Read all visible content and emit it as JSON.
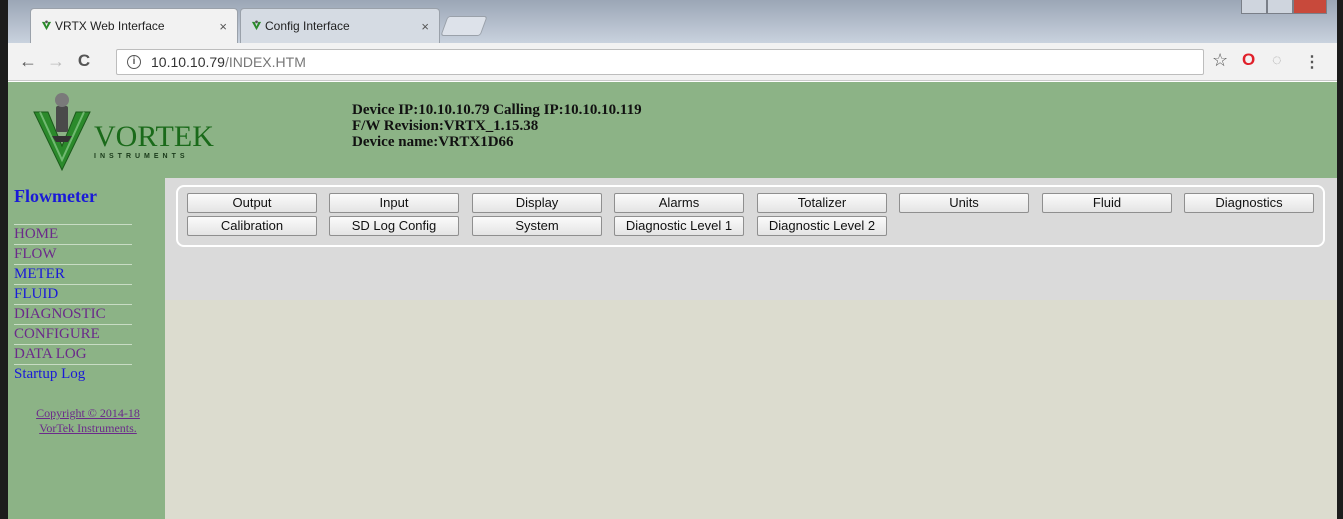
{
  "browser": {
    "tabs": [
      {
        "label": "VRTX Web Interface",
        "close": "×"
      },
      {
        "label": "Config Interface",
        "close": "×"
      }
    ],
    "url_host": "10.10.10.79",
    "url_path": "/INDEX.HTM",
    "info_icon": "i",
    "back_icon": "←",
    "forward_icon": "→",
    "reload_icon": "C",
    "star_icon": "☆",
    "opera_icon": "O",
    "ext_icon": "◌",
    "menu_icon": "⋮"
  },
  "header": {
    "logo_text": "VORTEK",
    "logo_sub": "INSTRUMENTS",
    "device_line": "Device IP:10.10.10.79 Calling IP:10.10.10.119",
    "firmware_line": "F/W Revision:VRTX_1.15.38",
    "name_line": "Device name:VRTX1D66"
  },
  "sidebar": {
    "title": "Flowmeter",
    "items": [
      {
        "label": "HOME"
      },
      {
        "label": "FLOW"
      },
      {
        "label": "METER"
      },
      {
        "label": "FLUID"
      },
      {
        "label": "DIAGNOSTIC"
      },
      {
        "label": "CONFIGURE"
      },
      {
        "label": "DATA LOG"
      },
      {
        "label": "Startup Log"
      }
    ],
    "copyright_line1": "Copyright © 2014-18",
    "copyright_line2": "VorTek Instruments."
  },
  "buttons": {
    "row1": [
      "Output",
      "Input",
      "Display",
      "Alarms",
      "Totalizer",
      "Units",
      "Fluid",
      "Diagnostics"
    ],
    "row2": [
      "Calibration",
      "SD Log Config",
      "System",
      "Diagnostic Level 1",
      "Diagnostic Level 2"
    ]
  },
  "colors": {
    "header_green": "#8cb386",
    "link_blue": "#1a1ad8",
    "visited_purple": "#6b2a8a"
  }
}
